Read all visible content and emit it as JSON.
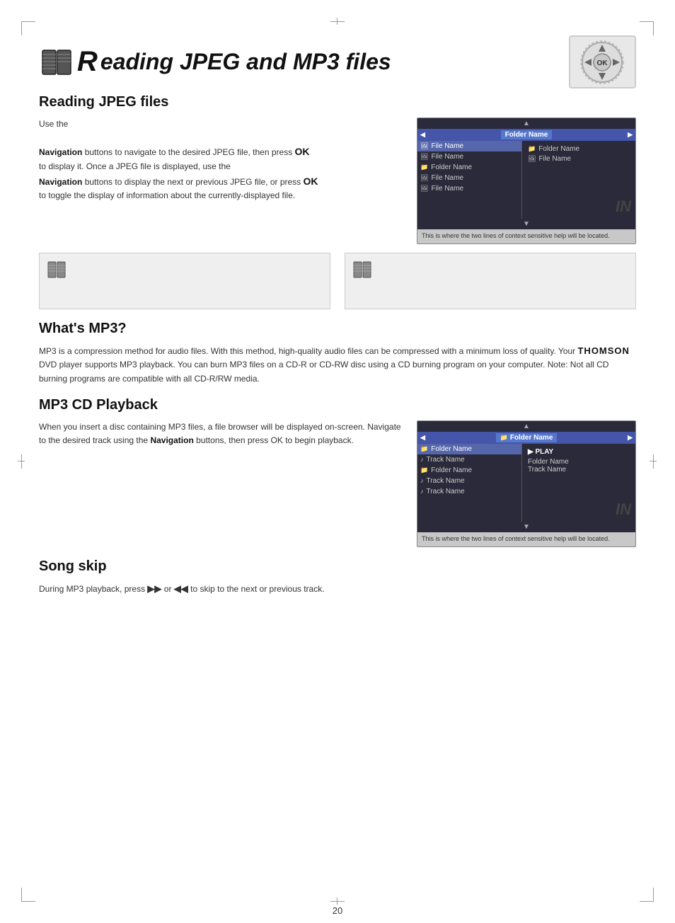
{
  "page": {
    "number": "20"
  },
  "title": {
    "prefix": "R",
    "rest": "eading JPEG and MP3 files",
    "full": "Reading JPEG and MP3 files"
  },
  "sections": {
    "reading_jpeg": {
      "heading": "Reading JPEG files",
      "body_line1": "Use the",
      "navigation1": "Navigation",
      "body_line2": "buttons to navigate to the desired JPEG file, then press",
      "ok1": "OK",
      "body_line3": "to display it. Once a JPEG file is displayed, use the",
      "navigation2": "Navigation",
      "body_line4": "buttons to display the next or previous JPEG file, or press",
      "ok2": "OK",
      "body_line5": "to toggle the display of information about the currently-displayed file."
    },
    "whats_mp3": {
      "heading": "What's MP3?",
      "body": "MP3 is a compression method for audio files. With this method, high-quality audio files can be compressed with a minimum loss of quality. Your",
      "thomson": "THOMSON",
      "body2": "DVD player supports MP3 playback. You can burn MP3 files on a CD-R or CD-RW disc using a CD burning program on your computer. Note: Not all CD burning programs are compatible with all CD-R/RW media."
    },
    "mp3_playback": {
      "heading": "MP3 CD Playback",
      "body": "When you insert a disc containing MP3 files, a file browser will be displayed on-screen. Navigate to the desired track using the",
      "navigation": "Navigation",
      "body2": "buttons, then press OK to begin playback."
    },
    "song_skip": {
      "heading": "Song skip",
      "body": "During MP3 playback, press",
      "ff": "▶▶",
      "body2": "or",
      "rw": "◀◀",
      "body3": "to skip to the next or previous track."
    }
  },
  "ui_jpeg": {
    "header_label": "Folder Name",
    "arrow_up": "▲",
    "arrow_down": "▼",
    "list_items": [
      {
        "icon": "file",
        "label": "File Name",
        "selected": true
      },
      {
        "icon": "file",
        "label": "File Name"
      },
      {
        "icon": "folder",
        "label": "Folder Name"
      },
      {
        "icon": "file",
        "label": "File Name"
      },
      {
        "icon": "file",
        "label": "File Name"
      }
    ],
    "detail_items": [
      {
        "icon": "folder",
        "label": "Folder Name"
      },
      {
        "icon": "file",
        "label": "File Name"
      }
    ],
    "help_text": "This is where the two lines of context sensitive help will be located."
  },
  "ui_mp3": {
    "header_label": "Folder Name",
    "play_label": "▶ PLAY",
    "folder_name": "Folder Name",
    "track_name": "Track Name",
    "arrow_up": "▲",
    "arrow_down": "▼",
    "list_items": [
      {
        "icon": "folder",
        "label": "Folder Name",
        "selected": true
      },
      {
        "icon": "music",
        "label": "Track Name"
      },
      {
        "icon": "folder",
        "label": "Folder Name"
      },
      {
        "icon": "music",
        "label": "Track Name"
      },
      {
        "icon": "music",
        "label": "Track Name"
      }
    ],
    "help_text": "This is where the two lines of context sensitive help will be located."
  },
  "note_boxes": [
    {
      "text": ""
    },
    {
      "text": ""
    }
  ],
  "icons": {
    "book": "📖",
    "ok_label": "OK"
  }
}
